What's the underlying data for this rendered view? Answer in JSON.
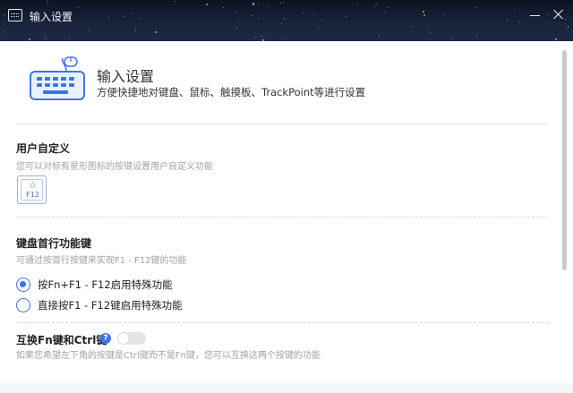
{
  "window": {
    "title": "输入设置",
    "app_icon": "keyboard-icon",
    "minimize_icon": "minimize-icon",
    "close_icon": "close-icon"
  },
  "header": {
    "icon": "keyboard-mouse-icon",
    "title": "输入设置",
    "subtitle": "方便快捷地对键盘、鼠标、触摸板、TrackPoint等进行设置"
  },
  "user_defined": {
    "title": "用户自定义",
    "description": "您可以对标有星形图标的按键设置用户自定义功能",
    "key_label": "F12",
    "key_icon": "star-icon"
  },
  "function_keys": {
    "title": "键盘首行功能键",
    "description": "可通过按首行按键来实现F1 - F12键的功能",
    "options": [
      {
        "label": "按Fn+F1 - F12启用特殊功能",
        "checked": true
      },
      {
        "label": "直接按F1 - F12键启用特殊功能",
        "checked": false
      }
    ]
  },
  "swap_fn_ctrl": {
    "title": "互换Fn键和Ctrl键",
    "help_icon": "question-icon",
    "help_glyph": "?",
    "enabled": false,
    "description": "如果您希望左下角的按键是Ctrl键而不是Fn键，您可以互换这两个按键的功能"
  },
  "colors": {
    "accent": "#3d73e8",
    "titlebar": "#18233a",
    "muted_text": "#a2a2a2"
  }
}
